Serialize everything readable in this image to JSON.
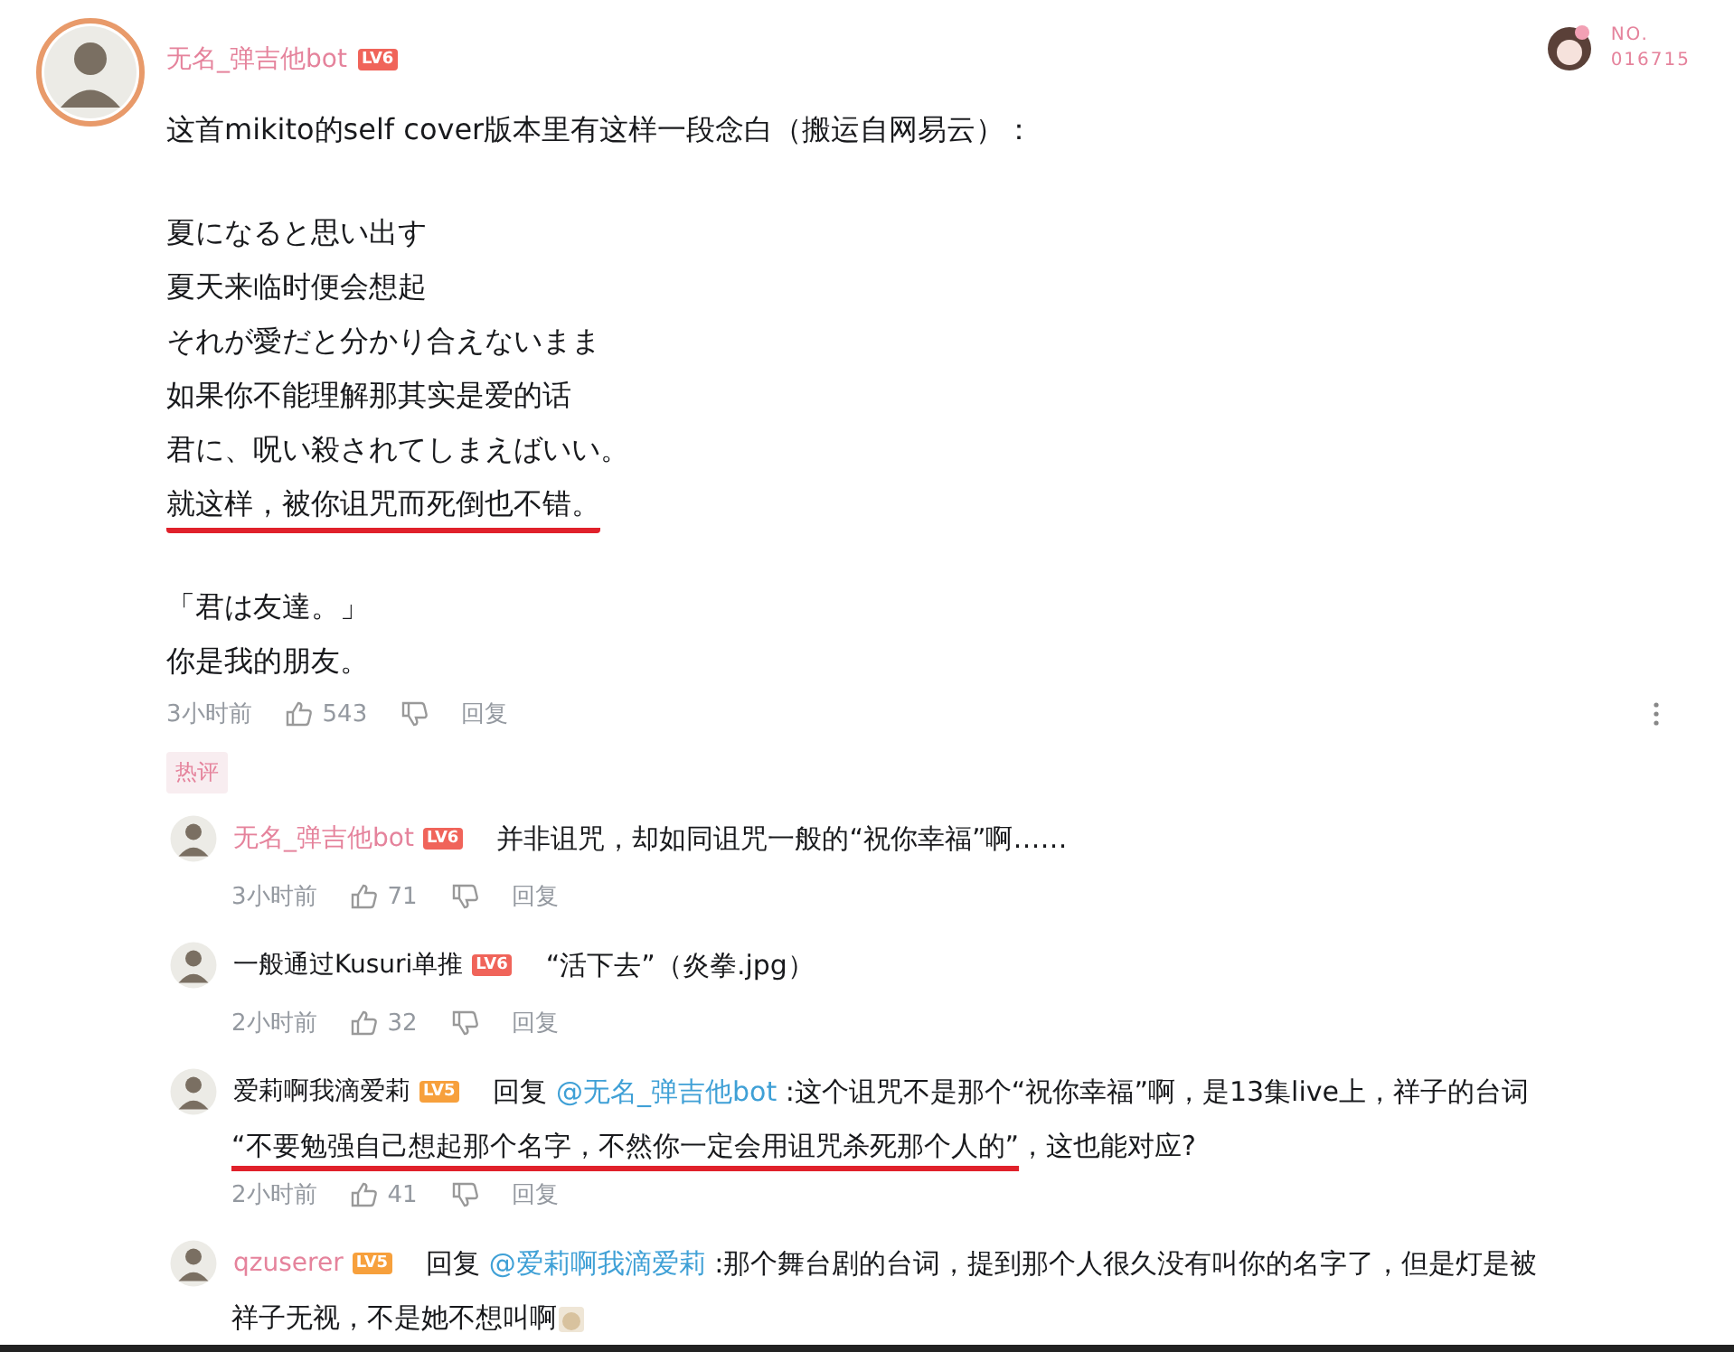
{
  "comment": {
    "user": "无名_弹吉他bot",
    "badge": {
      "label": "LV6",
      "color": "#f0645a"
    },
    "paragraphs": [
      [
        {
          "text": "这首mikito的self cover版本里有这样一段念白（搬运自网易云）：",
          "underlined": false
        }
      ],
      [
        {
          "text": "夏になると思い出す",
          "underlined": false
        },
        {
          "text": "夏天来临时便会想起",
          "underlined": false
        },
        {
          "text": "それが愛だと分かり合えないまま",
          "underlined": false
        },
        {
          "text": "如果你不能理解那其实是爱的话",
          "underlined": false
        },
        {
          "text": "君に、呪い殺されてしまえばいい。",
          "underlined": false
        },
        {
          "text": "就这样，被你诅咒而死倒也不错。",
          "underlined": true
        }
      ],
      [
        {
          "text": "「君は友達。」",
          "underlined": false
        },
        {
          "text": "你是我的朋友。",
          "underlined": false
        }
      ]
    ],
    "time": "3小时前",
    "likes": "543",
    "reply_label": "回复",
    "tag": "热评"
  },
  "top_right": {
    "no_label": "NO.",
    "number": "016715"
  },
  "replies": [
    {
      "user": "无名_弹吉他bot",
      "name_pink": true,
      "badge": {
        "label": "LV6",
        "color": "#f0645a"
      },
      "lines": [
        [
          {
            "kind": "plain",
            "text": "并非诅咒，却如同诅咒一般的“祝你幸福”啊……"
          }
        ]
      ],
      "time": "3小时前",
      "likes": "71",
      "reply_label": "回复"
    },
    {
      "user": "一般通过Kusuri单推",
      "name_pink": false,
      "badge": {
        "label": "LV6",
        "color": "#f0645a"
      },
      "lines": [
        [
          {
            "kind": "plain",
            "text": "“活下去”（炎拳.jpg）"
          }
        ]
      ],
      "time": "2小时前",
      "likes": "32",
      "reply_label": "回复"
    },
    {
      "user": "爱莉啊我滴爱莉",
      "name_pink": false,
      "badge": {
        "label": "LV5",
        "color": "#f7a03c"
      },
      "lines": [
        [
          {
            "kind": "plain",
            "text": "回复 "
          },
          {
            "kind": "mention",
            "text": "@无名_弹吉他bot"
          },
          {
            "kind": "plain",
            "text": " :这个诅咒不是那个“祝你幸福”啊，是13集live上，祥子的台词"
          }
        ],
        [
          {
            "kind": "underlined",
            "text": "“不要勉强自己想起那个名字，不然你一定会用诅咒杀死那个人的”"
          },
          {
            "kind": "plain",
            "text": "，这也能对应?"
          }
        ]
      ],
      "time": "2小时前",
      "likes": "41",
      "reply_label": "回复"
    },
    {
      "user": "qzuserer",
      "name_pink": true,
      "badge": {
        "label": "LV5",
        "color": "#f7a03c"
      },
      "lines": [
        [
          {
            "kind": "plain",
            "text": "回复 "
          },
          {
            "kind": "mention",
            "text": "@爱莉啊我滴爱莉"
          },
          {
            "kind": "plain",
            "text": " :那个舞台剧的台词，提到那个人很久没有叫你的名字了，但是灯是被"
          }
        ],
        [
          {
            "kind": "plain",
            "text": "祥子无视，不是她不想叫啊"
          }
        ]
      ],
      "sticker": true
    }
  ]
}
